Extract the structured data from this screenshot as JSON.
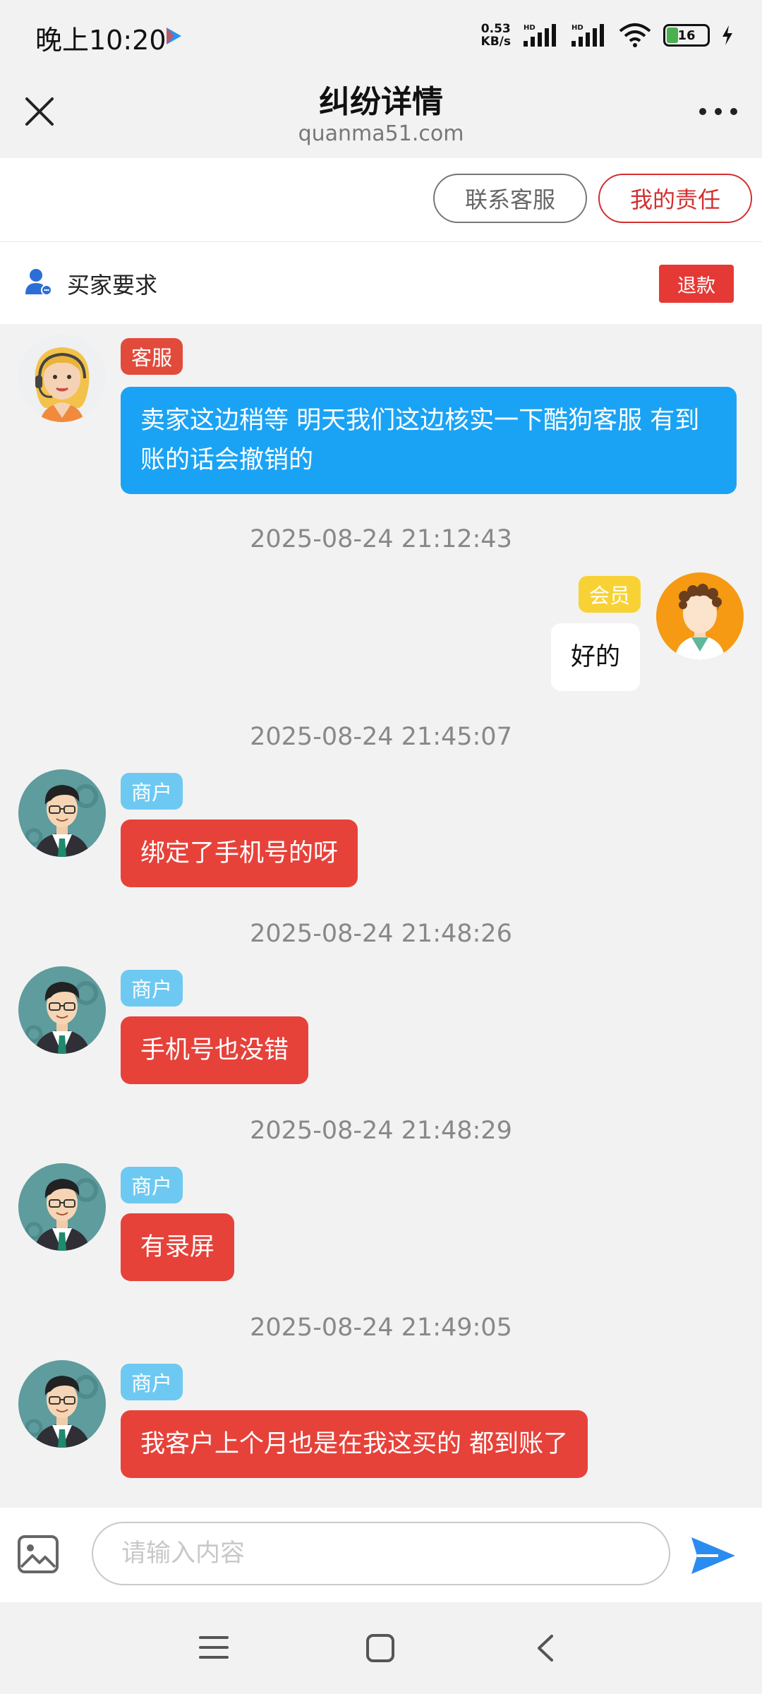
{
  "status_bar": {
    "time": "晚上10:20",
    "net_speed_value": "0.53",
    "net_speed_unit": "KB/s",
    "battery": "16"
  },
  "header": {
    "title": "纠纷详情",
    "subtitle": "quanma51.com"
  },
  "actions": {
    "contact_label": "联系客服",
    "responsibility_label": "我的责任"
  },
  "request": {
    "label": "买家要求",
    "refund_label": "退款"
  },
  "messages": [
    {
      "role_tag": "客服",
      "text": "卖家这边稍等 明天我们这边核实一下酷狗客服 有到账的话会撤销的"
    },
    {
      "timestamp": "2025-08-24 21:12:43",
      "role_tag": "会员",
      "text": "好的"
    },
    {
      "timestamp": "2025-08-24 21:45:07",
      "role_tag": "商户",
      "text": "绑定了手机号的呀"
    },
    {
      "timestamp": "2025-08-24 21:48:26",
      "role_tag": "商户",
      "text": "手机号也没错"
    },
    {
      "timestamp": "2025-08-24 21:48:29",
      "role_tag": "商户",
      "text": "有录屏"
    },
    {
      "timestamp": "2025-08-24 21:49:05",
      "role_tag": "商户",
      "text": "我客户上个月也是在我这买的 都到账了"
    }
  ],
  "composer": {
    "placeholder": "请输入内容",
    "value": ""
  },
  "colors": {
    "accent_red": "#e6423a",
    "bubble_blue": "#1aa3f5",
    "member_tag": "#f8d234",
    "merchant_tag": "#6dc9f2",
    "send_blue": "#2a8cf0"
  },
  "icons": {
    "close": "close-icon",
    "more": "more-icon",
    "buyer": "buyer-icon",
    "image": "image-icon",
    "send": "send-icon",
    "nav_menu": "menu-icon",
    "nav_home": "home-icon",
    "nav_back": "back-icon"
  }
}
